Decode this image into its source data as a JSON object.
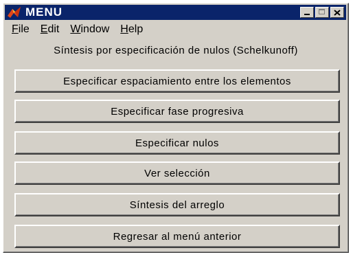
{
  "window": {
    "title": "MENU",
    "app_icon": "matlab-icon",
    "title_bar_color": "#0a246a",
    "controls": [
      {
        "name": "minimize",
        "icon": "minimize-icon"
      },
      {
        "name": "maximize",
        "icon": "maximize-icon"
      },
      {
        "name": "close",
        "icon": "close-icon"
      }
    ]
  },
  "menubar": {
    "items": [
      {
        "label_hotkey": "F",
        "label_rest": "ile"
      },
      {
        "label_hotkey": "E",
        "label_rest": "dit"
      },
      {
        "label_hotkey": "W",
        "label_rest": "indow"
      },
      {
        "label_hotkey": "H",
        "label_rest": "elp"
      }
    ]
  },
  "main": {
    "heading": "Síntesis por especificación de nulos (Schelkunoff)",
    "buttons": [
      {
        "label": "Especificar espaciamiento entre los elementos"
      },
      {
        "label": "Especificar fase progresiva"
      },
      {
        "label": "Especificar nulos"
      },
      {
        "label": "Ver selección"
      },
      {
        "label": "Síntesis del arreglo"
      },
      {
        "label": "Regresar al menú anterior"
      }
    ]
  }
}
